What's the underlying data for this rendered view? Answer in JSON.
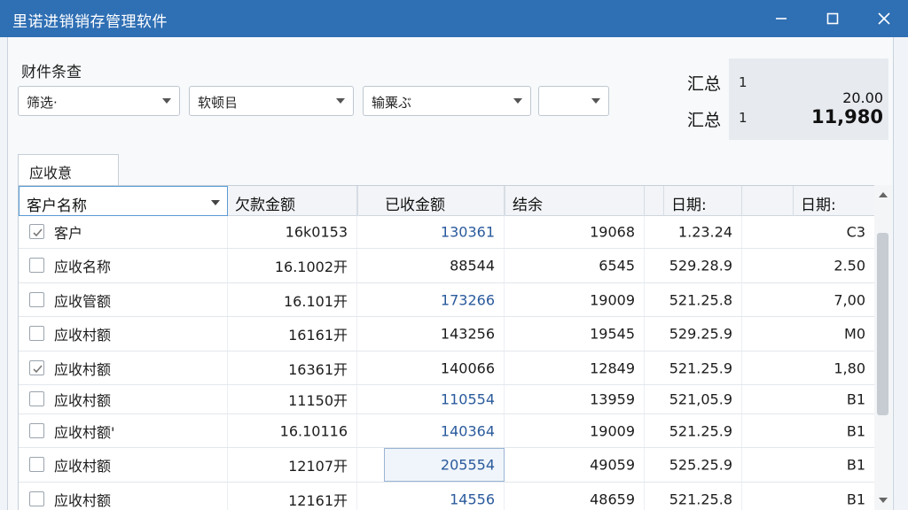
{
  "window": {
    "title": "里诺进销销存管理软件",
    "minimize_icon": "minimize-icon",
    "maximize_icon": "maximize-icon",
    "close_icon": "close-icon"
  },
  "filters": {
    "section_label": "财件条查",
    "combos": [
      {
        "value": "筛选·"
      },
      {
        "value": "软顿㠯"
      },
      {
        "value": "输粟ぶ"
      },
      {
        "value": ""
      }
    ]
  },
  "summary": {
    "label1": "汇总",
    "num1": "1",
    "value1": "20.00",
    "label2": "汇总",
    "num2": "1",
    "value2": "11,980"
  },
  "tab": {
    "label": "应收意"
  },
  "table": {
    "headers": [
      "客户名称",
      "欠款金额",
      "已收金额",
      "结余",
      "日期:",
      "日期:"
    ],
    "rows": [
      {
        "checked": true,
        "name": "客户",
        "owed": "16k0153",
        "received": "130361",
        "balance": "19068",
        "date": "1.23.24",
        "last": "C3"
      },
      {
        "checked": false,
        "name": "应收名称",
        "owed": "16.1002开",
        "received": "88544",
        "balance": "6545",
        "date": "529.28.9",
        "last": "2.50"
      },
      {
        "checked": false,
        "name": "应收管额",
        "owed": "16.101开",
        "received": "173266",
        "balance": "19009",
        "date": "521.25.8",
        "last": "7,00"
      },
      {
        "checked": false,
        "name": "应收村额",
        "owed": "16161开",
        "received": "143256",
        "balance": "19545",
        "date": "529.25.9",
        "last": "M0"
      },
      {
        "checked": true,
        "name": "应收村额",
        "owed": "16361开",
        "received": "140066",
        "balance": "12849",
        "date": "521.25.9",
        "last": "1,80"
      },
      {
        "checked": false,
        "name": "应收村额",
        "owed": "11150开",
        "received": "110554",
        "balance": "13959",
        "date": "521,05.9",
        "last": "B1"
      },
      {
        "checked": false,
        "name": "应收村额'",
        "owed": "16.10116",
        "received": "140364",
        "balance": "19009",
        "date": "521.25.9",
        "last": "B1"
      },
      {
        "checked": false,
        "name": "应收村额",
        "owed": "12107开",
        "received": "205554",
        "balance": "49059",
        "date": "525.25.9",
        "last": "B1"
      },
      {
        "checked": false,
        "name": "应收村额",
        "owed": "12161开",
        "received": "14556",
        "balance": "48659",
        "date": "521.25.8",
        "last": "B1"
      }
    ]
  },
  "colors": {
    "titlebar": "#2f6fb4",
    "link_blue": "#2a5a9c"
  }
}
